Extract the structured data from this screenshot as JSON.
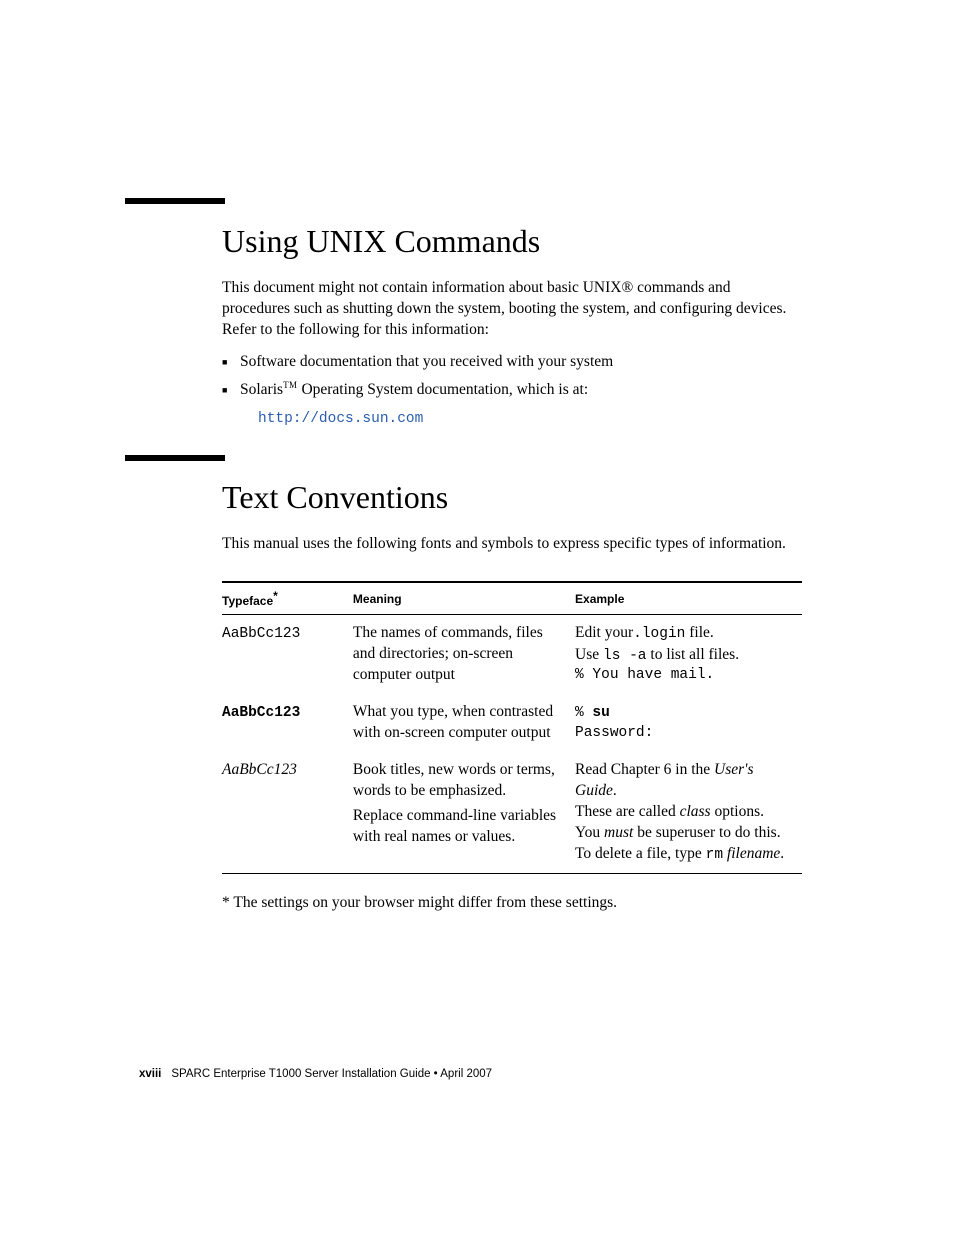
{
  "section1": {
    "heading": "Using UNIX Commands",
    "para": "This document might not contain information about basic UNIX® commands and procedures such as shutting down the system, booting the system, and configuring devices. Refer to the following for this information:",
    "bullets": {
      "b1": "Software documentation that you received with your system",
      "b2_pre": "Solaris",
      "b2_tm": "TM",
      "b2_post": " Operating System documentation, which is at:",
      "link": "http://docs.sun.com"
    }
  },
  "section2": {
    "heading": "Text Conventions",
    "para": "This manual uses the following fonts and symbols to express specific types of information.",
    "table": {
      "headers": {
        "c1": "Typeface",
        "c1_star": "*",
        "c2": "Meaning",
        "c3": "Example"
      },
      "rows": [
        {
          "typeface": "AaBbCc123",
          "typeface_class": "mono",
          "meaning": "The names of commands, files and directories; on-screen computer output",
          "example": {
            "l1_pre": "Edit your",
            "l1_code": ".login",
            "l1_post": " file.",
            "l2_pre": "Use ",
            "l2_code": "ls -a",
            "l2_post": " to list all files.",
            "l3": "% You have mail."
          }
        },
        {
          "typeface": "AaBbCc123",
          "typeface_class": "monob",
          "meaning": "What you type, when contrasted with on-screen computer output",
          "example": {
            "l1_pct": "% ",
            "l1_cmd": "su",
            "l2": "Password:"
          }
        },
        {
          "typeface": "AaBbCc123",
          "typeface_class": "ital",
          "meaning1": "Book titles, new words or terms, words to be emphasized.",
          "meaning2": "Replace command-line variables with real names or values.",
          "example": {
            "l1_pre": "Read Chapter 6 in the ",
            "l1_it": "User's Guide",
            "l1_post": ".",
            "l2_pre": "These are called ",
            "l2_it": "class",
            "l2_post": " options.",
            "l3_pre": "You ",
            "l3_it": "must",
            "l3_post": " be superuser to do this.",
            "l4_pre": "To delete a file, type ",
            "l4_code": "rm",
            "l4_it": "filename",
            "l4_post": "."
          }
        }
      ]
    },
    "footnote": "* The settings on your browser might differ from these settings."
  },
  "footer": {
    "page": "xviii",
    "title": "SPARC Enterprise T1000 Server Installation Guide  •  April 2007"
  }
}
